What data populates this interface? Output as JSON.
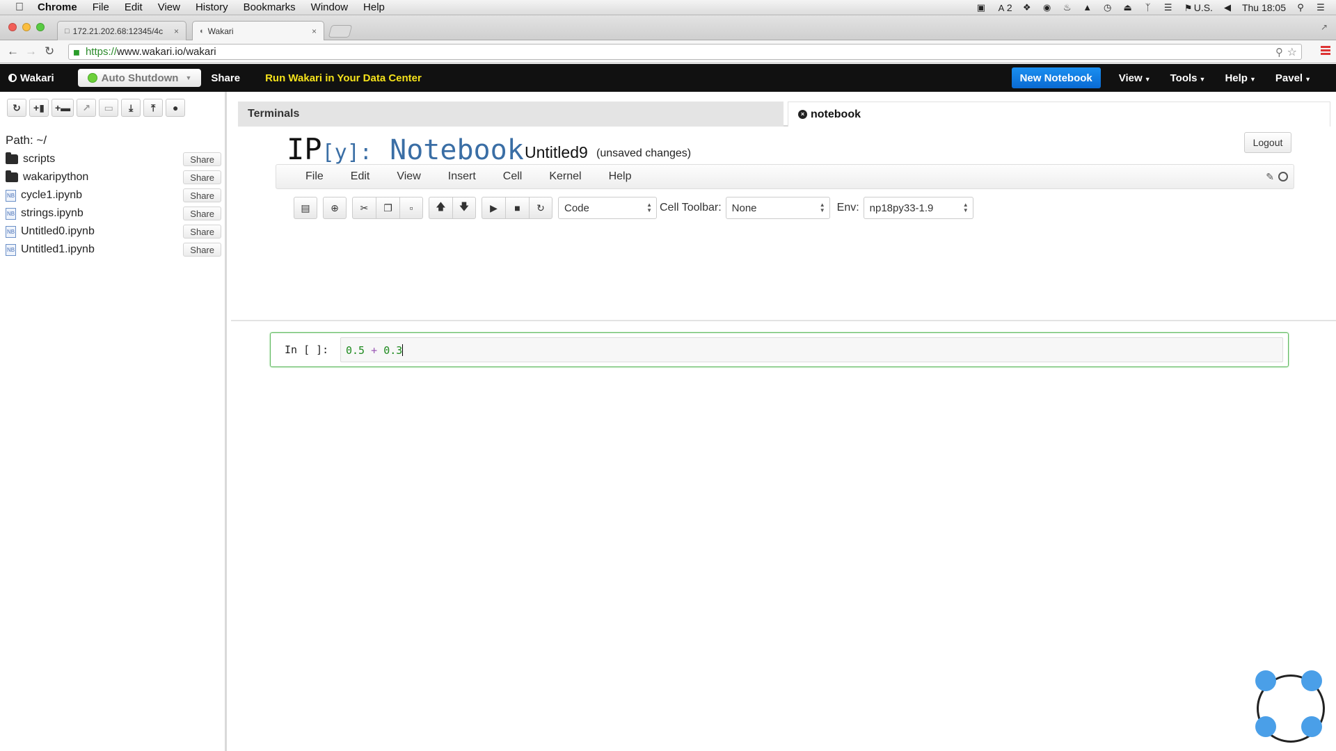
{
  "os_menubar": {
    "app": "Chrome",
    "menus": [
      "File",
      "Edit",
      "View",
      "History",
      "Bookmarks",
      "Window",
      "Help"
    ],
    "tray": {
      "notification_count": "2",
      "input_source": "U.S.",
      "clock": "Thu 18:05"
    }
  },
  "browser": {
    "tabs": [
      {
        "title": "172.21.202.68:12345/4c",
        "active": false
      },
      {
        "title": "Wakari",
        "active": true
      }
    ],
    "url_scheme": "https://",
    "url_rest": "www.wakari.io/wakari"
  },
  "wakari_nav": {
    "brand": "Wakari",
    "auto_shutdown": "Auto Shutdown",
    "share": "Share",
    "promo": "Run Wakari in Your Data Center",
    "new_notebook": "New Notebook",
    "view": "View",
    "tools": "Tools",
    "help": "Help",
    "user": "Pavel",
    "colors": {
      "promo": "#f5e21b",
      "new_notebook": "#0f7ae0",
      "status_dot": "#6ccf3a"
    }
  },
  "sidebar": {
    "path": "Path: ~/",
    "share_label": "Share",
    "files": [
      {
        "name": "scripts",
        "type": "folder"
      },
      {
        "name": "wakaripython",
        "type": "folder"
      },
      {
        "name": "cycle1.ipynb",
        "type": "notebook"
      },
      {
        "name": "strings.ipynb",
        "type": "notebook"
      },
      {
        "name": "Untitled0.ipynb",
        "type": "notebook"
      },
      {
        "name": "Untitled1.ipynb",
        "type": "notebook"
      }
    ]
  },
  "main": {
    "tabs": [
      "Terminals",
      "notebook"
    ],
    "logo_ip": "IP",
    "logo_y": "[y]:",
    "logo_notebook": "Notebook",
    "notebook_name": "Untitled9",
    "notebook_status": "(unsaved changes)",
    "logout": "Logout",
    "menu": [
      "File",
      "Edit",
      "View",
      "Insert",
      "Cell",
      "Kernel",
      "Help"
    ],
    "toolbar": {
      "cell_type": "Code",
      "cell_toolbar_label": "Cell Toolbar:",
      "cell_toolbar_value": "None",
      "env_label": "Env:",
      "env_value": "np18py33-1.9"
    },
    "cell": {
      "prompt": "In [ ]:",
      "code_a": "0.5",
      "code_op": "+",
      "code_b": "0.3"
    }
  }
}
